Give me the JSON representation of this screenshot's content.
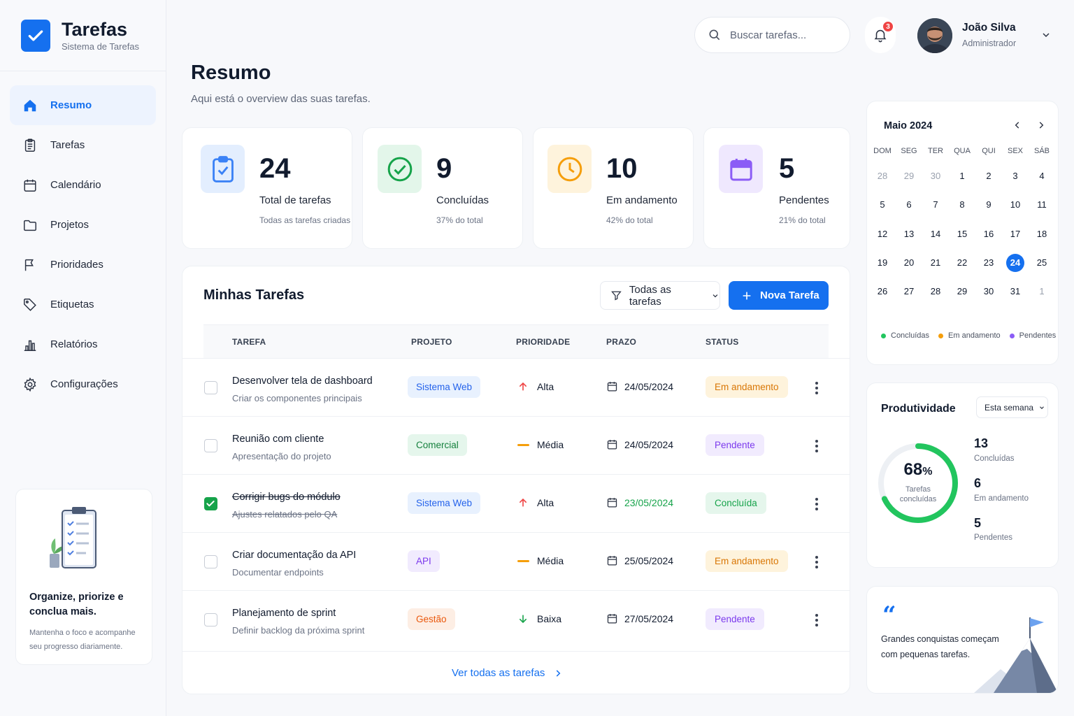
{
  "brand": {
    "title": "Tarefas",
    "subtitle": "Sistema de Tarefas"
  },
  "nav": [
    {
      "label": "Resumo",
      "icon": "home-icon",
      "active": true
    },
    {
      "label": "Tarefas",
      "icon": "clipboard-icon"
    },
    {
      "label": "Calendário",
      "icon": "calendar-icon"
    },
    {
      "label": "Projetos",
      "icon": "folder-icon"
    },
    {
      "label": "Prioridades",
      "icon": "flag-icon"
    },
    {
      "label": "Etiquetas",
      "icon": "tag-icon"
    },
    {
      "label": "Relatórios",
      "icon": "bar-chart-icon"
    },
    {
      "label": "Configurações",
      "icon": "gear-icon"
    }
  ],
  "promo": {
    "title": "Organize, priorize e conclua mais.",
    "text": "Mantenha o foco e acompanhe seu progresso diariamente."
  },
  "header": {
    "title": "Resumo",
    "subtitle": "Aqui está o overview das suas tarefas.",
    "search_placeholder": "Buscar tarefas...",
    "notifications": "3",
    "user_name": "João Silva",
    "user_role": "Administrador"
  },
  "stats": [
    {
      "value": "24",
      "label": "Total de tarefas",
      "note": "Todas as tarefas criadas",
      "icon": "clipboard-check-icon",
      "color": "#3b82f6",
      "bg": "#e3eefe"
    },
    {
      "value": "9",
      "label": "Concluídas",
      "note": "37% do total",
      "icon": "check-circle-icon",
      "color": "#16a34a",
      "bg": "#e3f6ea"
    },
    {
      "value": "10",
      "label": "Em andamento",
      "note": "42% do total",
      "icon": "clock-icon",
      "color": "#f59e0b",
      "bg": "#fef3dc"
    },
    {
      "value": "5",
      "label": "Pendentes",
      "note": "21% do total",
      "icon": "calendar-icon",
      "color": "#8b5cf6",
      "bg": "#efe8fe"
    }
  ],
  "tasks": {
    "title": "Minhas Tarefas",
    "filter": "Todas as tarefas",
    "new_button": "Nova Tarefa",
    "columns": [
      "TAREFA",
      "PROJETO",
      "PRIORIDADE",
      "PRAZO",
      "STATUS"
    ],
    "see_all": "Ver todas as tarefas",
    "rows": [
      {
        "title": "Desenvolver tela de dashboard",
        "desc": "Criar os componentes principais",
        "project": "Sistema Web",
        "priority": "Alta",
        "due": "24/05/2024",
        "status": "Em andamento",
        "done": false
      },
      {
        "title": "Reunião com cliente",
        "desc": "Apresentação do projeto",
        "project": "Comercial",
        "priority": "Média",
        "due": "24/05/2024",
        "status": "Pendente",
        "done": false
      },
      {
        "title": "Corrigir bugs do módulo",
        "desc": "Ajustes relatados pelo QA",
        "project": "Sistema Web",
        "priority": "Alta",
        "due": "23/05/2024",
        "status": "Concluída",
        "done": true
      },
      {
        "title": "Criar documentação da API",
        "desc": "Documentar endpoints",
        "project": "API",
        "priority": "Média",
        "due": "25/05/2024",
        "status": "Em andamento",
        "done": false
      },
      {
        "title": "Planejamento de sprint",
        "desc": "Definir backlog da próxima sprint",
        "project": "Gestão",
        "priority": "Baixa",
        "due": "27/05/2024",
        "status": "Pendente",
        "done": false
      }
    ]
  },
  "calendar": {
    "month": "Maio 2024",
    "days_of_week": [
      "DOM",
      "SEG",
      "TER",
      "QUA",
      "QUI",
      "SEX",
      "SÁB"
    ],
    "weeks": [
      [
        "28",
        "29",
        "30",
        "1",
        "2",
        "3",
        "4"
      ],
      [
        "5",
        "6",
        "7",
        "8",
        "9",
        "10",
        "11"
      ],
      [
        "12",
        "13",
        "14",
        "15",
        "16",
        "17",
        "18"
      ],
      [
        "19",
        "20",
        "21",
        "22",
        "23",
        "24",
        "25"
      ],
      [
        "26",
        "27",
        "28",
        "29",
        "30",
        "31",
        "1"
      ]
    ],
    "selected": "24",
    "legend": [
      {
        "label": "Concluídas",
        "color": "#22c55e"
      },
      {
        "label": "Em andamento",
        "color": "#f59e0b"
      },
      {
        "label": "Pendentes",
        "color": "#8b5cf6"
      }
    ]
  },
  "productivity": {
    "title": "Produtividade",
    "period": "Esta semana",
    "percent": 68,
    "percent_label": "Tarefas concluídas",
    "metrics": [
      {
        "value": "13",
        "label": "Concluídas"
      },
      {
        "value": "6",
        "label": "Em andamento"
      },
      {
        "value": "5",
        "label": "Pendentes"
      }
    ]
  },
  "quote": {
    "text": "Grandes conquistas começam com pequenas tarefas."
  }
}
